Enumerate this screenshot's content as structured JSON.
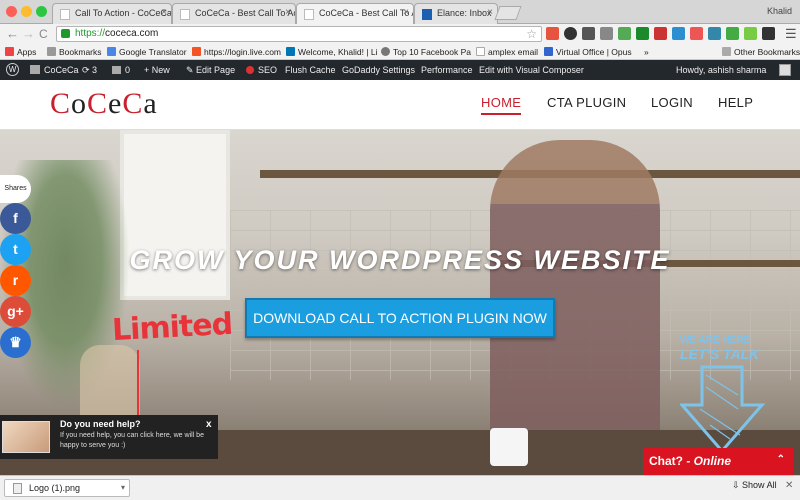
{
  "browser": {
    "tabs": [
      {
        "label": "Call To Action - CoCeCa – "
      },
      {
        "label": "CoCeCa - Best Call To Acti"
      },
      {
        "label": "CoCeCa - Best Call To Acti"
      },
      {
        "label": "Elance: Inbox"
      }
    ],
    "profile": "Khalid",
    "url_scheme": "https://",
    "url_host": "coceca.com",
    "back": "←",
    "forward": "→",
    "reload": "C",
    "star": "☆",
    "menu": "☰"
  },
  "bookmarks": [
    {
      "label": "Apps"
    },
    {
      "label": "Bookmarks"
    },
    {
      "label": "Google Translator"
    },
    {
      "label": "https://login.live.com"
    },
    {
      "label": "Welcome, Khalid! | Li"
    },
    {
      "label": "Top 10 Facebook Pa"
    },
    {
      "label": "amplex email"
    },
    {
      "label": "Virtual Office | Opus"
    },
    {
      "label": "»"
    },
    {
      "label": "Other Bookmarks"
    }
  ],
  "adminbar": {
    "wp_logo": "W",
    "site": "CoCeCa",
    "updates": "3",
    "comments": "0",
    "new": "New",
    "edit_page": "Edit Page",
    "seo": "SEO",
    "flush_cache": "Flush Cache",
    "godaddy": "GoDaddy Settings",
    "performance": "Performance",
    "visual_composer": "Edit with Visual Composer",
    "howdy": "Howdy, ashish sharma"
  },
  "site": {
    "logo_a": "C",
    "logo_b": "o",
    "logo_c": "C",
    "logo_d": "e",
    "logo_e": "C",
    "logo_f": "a",
    "nav": [
      {
        "label": "HOME"
      },
      {
        "label": "CTA PLUGIN"
      },
      {
        "label": "LOGIN"
      },
      {
        "label": "HELP"
      }
    ]
  },
  "hero": {
    "title": "GROW YOUR WORDPRESS WEBSITE",
    "cta": "DOWNLOAD CALL TO ACTION PLUGIN NOW",
    "limited": "Limited",
    "we_are_here": "WE ARE HERE",
    "lets_talk": "LET'S TALK"
  },
  "share": {
    "label": "Shares",
    "buttons": [
      {
        "glyph": "f",
        "color": "#3b5998"
      },
      {
        "glyph": "t",
        "color": "#1da1f2"
      },
      {
        "glyph": "r",
        "color": "#ff5700"
      },
      {
        "glyph": "g+",
        "color": "#dd4b39"
      },
      {
        "glyph": "♛",
        "color": "#2a6fcf"
      }
    ]
  },
  "help": {
    "title": "Do you need help?",
    "text": "If you need help, you can click here, we will be happy to serve you :)",
    "close": "x"
  },
  "chat": {
    "label": "Chat?",
    "status": " - Online",
    "chevron": "⌃"
  },
  "downloads": {
    "file": "Logo (1).png",
    "caret": "▾",
    "show_all": "Show All",
    "close": "✕"
  },
  "colors": {
    "brand_red": "#c8202e",
    "cta_blue": "#1b9ee0",
    "chat_red": "#d9131f",
    "adminbar": "#23282d"
  }
}
